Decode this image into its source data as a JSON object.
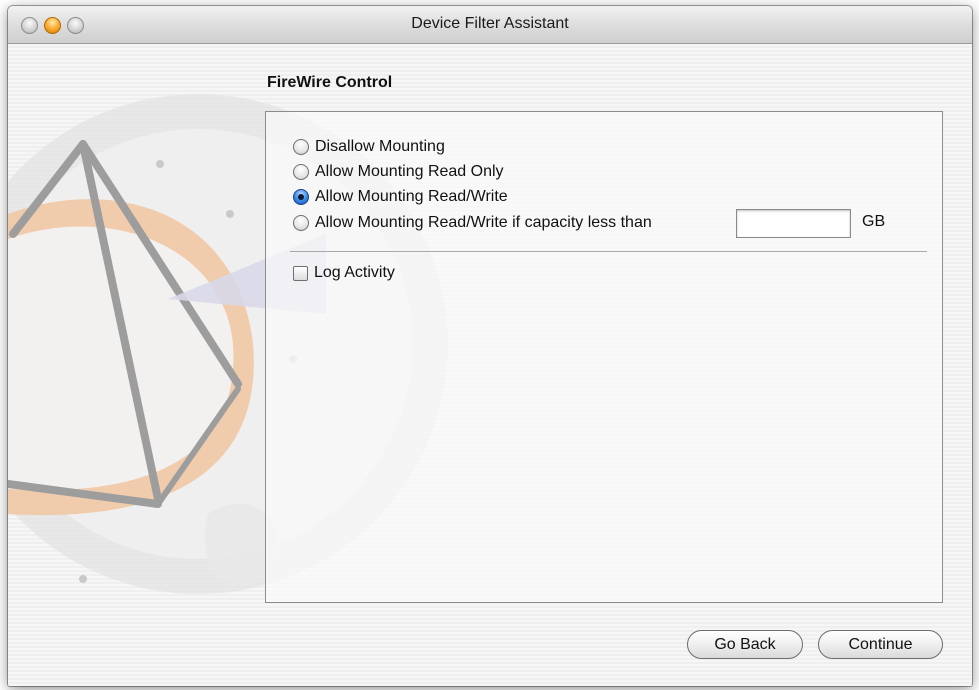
{
  "window": {
    "title": "Device Filter Assistant"
  },
  "section": {
    "heading": "FireWire Control"
  },
  "options": [
    {
      "label": "Disallow Mounting",
      "selected": false
    },
    {
      "label": "Allow Mounting Read Only",
      "selected": false
    },
    {
      "label": "Allow Mounting Read/Write",
      "selected": true
    },
    {
      "label": "Allow Mounting Read/Write if capacity less than",
      "selected": false
    }
  ],
  "capacity": {
    "value": "",
    "unit": "GB"
  },
  "log_activity": {
    "label": "Log Activity",
    "checked": false
  },
  "buttons": {
    "back": "Go Back",
    "continue": "Continue"
  },
  "colors": {
    "accent": "#3f8ee9",
    "window_bg": "#f3f3f3",
    "close_minimize": "#f7a52a"
  }
}
